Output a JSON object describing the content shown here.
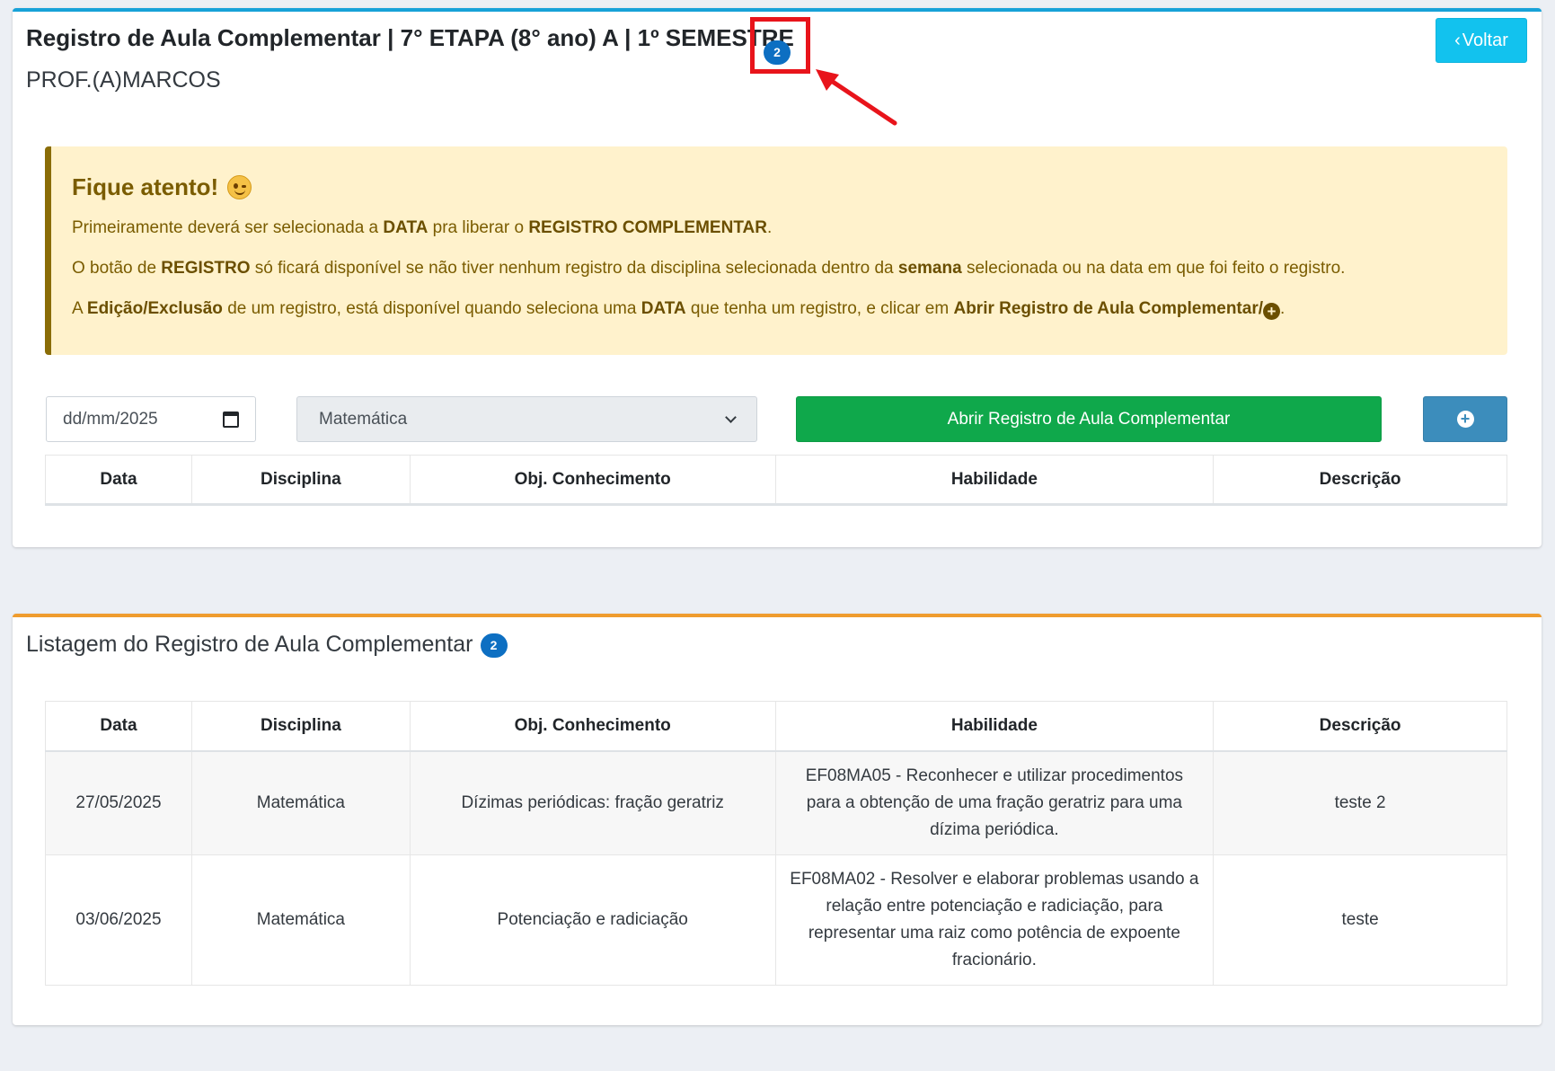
{
  "header": {
    "title": "Registro de Aula Complementar | 7° ETAPA (8° ano) A | 1º SEMESTRE",
    "badge_count": "2",
    "teacher": "PROF.(A)MARCOS",
    "back_button": "Voltar"
  },
  "alert": {
    "heading": "Fique atento!",
    "line1": {
      "a": "Primeiramente deverá ser selecionada a ",
      "b": "DATA",
      "c": " pra liberar o ",
      "d": "REGISTRO COMPLEMENTAR",
      "e": "."
    },
    "line2": {
      "a": "O botão de ",
      "b": "REGISTRO",
      "c": " só ficará disponível se não tiver nenhum registro da disciplina selecionada dentro da ",
      "d": "semana",
      "e": " selecionada ou na data em que foi feito o registro."
    },
    "line3": {
      "a": "A ",
      "b": "Edição/Exclusão",
      "c": " de um registro, está disponível quando seleciona uma ",
      "d": "DATA",
      "e": " que tenha um registro, e clicar em ",
      "f": "Abrir Registro de Aula Complementar/",
      "g": "."
    }
  },
  "form": {
    "date_value": "dd/mm/2025",
    "subject_selected": "Matemática",
    "open_button": "Abrir Registro de Aula Complementar"
  },
  "columns": [
    "Data",
    "Disciplina",
    "Obj. Conhecimento",
    "Habilidade",
    "Descrição"
  ],
  "listing": {
    "title": "Listagem do Registro de Aula Complementar",
    "badge_count": "2",
    "rows": [
      {
        "data": "27/05/2025",
        "disciplina": "Matemática",
        "obj": "Dízimas periódicas: fração geratriz",
        "habilidade": "EF08MA05 - Reconhecer e utilizar procedimentos para a obtenção de uma fração geratriz para uma dízima periódica.",
        "descricao": "teste 2"
      },
      {
        "data": "03/06/2025",
        "disciplina": "Matemática",
        "obj": "Potenciação e radiciação",
        "habilidade": "EF08MA02 - Resolver e elaborar problemas usando a relação entre potenciação e radiciação, para representar uma raiz como potência de expoente fracionário.",
        "descricao": "teste"
      }
    ]
  },
  "colors": {
    "top_card_accent": "#17a2d8",
    "list_card_accent": "#ef9c2e",
    "badge": "#0d6fc2",
    "annotation_red": "#e8141b",
    "open_button": "#0fa84b",
    "plus_button": "#3c8dbc",
    "back_button": "#12c2ee",
    "alert_bg": "#fff2cc"
  },
  "icons": {
    "back": "chevron-left-icon",
    "date": "calendar-icon",
    "select": "chevron-down-icon",
    "plus": "plus-circle-icon",
    "emoji": "winking-face-icon"
  }
}
